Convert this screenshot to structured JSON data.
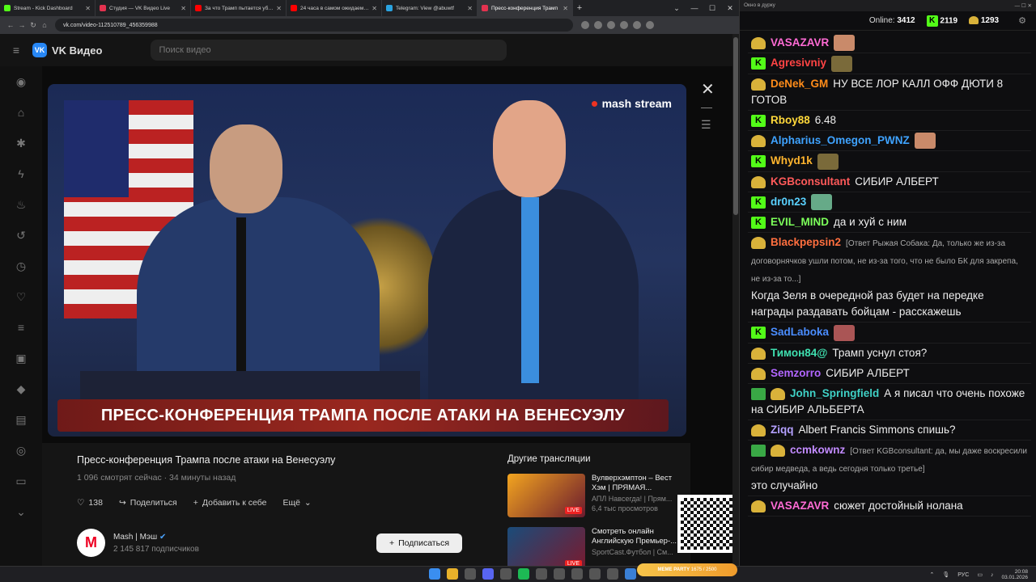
{
  "browser": {
    "tabs": [
      {
        "title": "Stream - Kick Dashboard",
        "color": "#53fc18"
      },
      {
        "title": "Студия — VK Видео Live",
        "color": "#e3324f"
      },
      {
        "title": "За что Трамп пытается убить",
        "color": "#ff0000"
      },
      {
        "title": "24 часа в самом ожидаемом",
        "color": "#ff0000"
      },
      {
        "title": "Telegram: View @abuwtf",
        "color": "#2aa3e0"
      },
      {
        "title": "Пресс-конференция Трамп",
        "color": "#e3324f"
      }
    ],
    "url": "vk.com/video-112510789_456359988",
    "ext_badge": "574"
  },
  "vk": {
    "logo": "VK Видео",
    "search_placeholder": "Поиск видео"
  },
  "player": {
    "brand": "mash stream",
    "lower_third": "ПРЕСС-КОНФЕРЕНЦИЯ ТРАМПА ПОСЛЕ АТАКИ НА ВЕНЕСУЭЛУ"
  },
  "video": {
    "title": "Пресс-конференция Трампа после атаки на Венесуэлу",
    "meta": "1 096 смотрят сейчас · 34 минуты назад",
    "likes": "138",
    "share": "Поделиться",
    "add": "Добавить к себе",
    "more": "Ещё",
    "channel": "Mash | Мэш",
    "subscribers": "2 145 817 подписчиков",
    "subscribe": "Подписаться"
  },
  "related": {
    "heading": "Другие трансляции",
    "items": [
      {
        "title": "Вулверхэмптон – Вест Хэм | ПРЯМАЯ...",
        "sub": "АПЛ Навсегда! | Прям...",
        "views": "6,4 тыс просмотров",
        "live": "LIVE"
      },
      {
        "title": "Смотреть онлайн Английскую Премьер-...",
        "sub": "SportCast.Футбол | См...",
        "views": "",
        "live": "LIVE"
      }
    ]
  },
  "chat": {
    "window_title": "Окно в дурку",
    "online_label": "Online:",
    "online": "3412",
    "kick_count": "2119",
    "gold_count": "1293",
    "messages": [
      {
        "badge": "g",
        "name": "VASAZAVR",
        "color": "#ff6bd5",
        "text": "",
        "reply": ""
      },
      {
        "badge": "k",
        "name": "Agresivniy",
        "color": "#ff4444",
        "text": "",
        "reply": ""
      },
      {
        "badge": "g",
        "name": "DeNek_GM",
        "color": "#ff8c1a",
        "text": "НУ ВСЕ ЛОР КАЛЛ ОФФ ДЮТИ 8 ГОТОВ",
        "reply": ""
      },
      {
        "badge": "k",
        "name": "Rboy88",
        "color": "#ffd83a",
        "text": "6.48",
        "reply": ""
      },
      {
        "badge": "g",
        "name": "Alpharius_Omegon_PWNZ",
        "color": "#3fa3ff",
        "text": "",
        "reply": ""
      },
      {
        "badge": "k",
        "name": "Whyd1k",
        "color": "#ffb52e",
        "text": "",
        "reply": ""
      },
      {
        "badge": "g",
        "name": "KGBconsultant",
        "color": "#ff5a5a",
        "text": "СИБИР АЛБЕРТ",
        "reply": ""
      },
      {
        "badge": "k",
        "name": "dr0n23",
        "color": "#5ad1ff",
        "text": "",
        "reply": ""
      },
      {
        "badge": "k",
        "name": "EVIL_MIND",
        "color": "#7cff5a",
        "text": "да и хуй с ним",
        "reply": ""
      },
      {
        "badge": "g",
        "name": "Blackpepsin2",
        "color": "#ff6f3f",
        "text": "Когда Зеля в очередной раз будет на передке награды раздавать бойцам - расскажешь",
        "reply": "[Ответ Рыжая Собака: Да, только же из-за договорнячков ушли потом, не из-за того, что не было БК для закрепа, не из-за то...]"
      },
      {
        "badge": "k",
        "name": "SadLaboka",
        "color": "#4a8dff",
        "text": "",
        "reply": ""
      },
      {
        "badge": "g",
        "name": "Тимон84@",
        "color": "#3fe0b0",
        "text": "Трамп уснул стоя?",
        "reply": ""
      },
      {
        "badge": "g",
        "name": "Semzorro",
        "color": "#b266ff",
        "text": "СИБИР АЛБЕРТ",
        "reply": ""
      },
      {
        "badge": "vg",
        "name": "John_Springfield",
        "color": "#3fd1c6",
        "text": "А я писал что очень похоже на СИБИР АЛЬБЕРТА",
        "reply": ""
      },
      {
        "badge": "g",
        "name": "Ziqq",
        "color": "#b4a0ff",
        "text": "Albert Francis Simmons спишь?",
        "reply": ""
      },
      {
        "badge": "vg",
        "name": "ccmkownz",
        "color": "#c28bff",
        "text": "это случайно",
        "reply": "[Ответ KGBconsultant: да, мы даже воскресили сибир медведа, а ведь сегодня только третье]"
      },
      {
        "badge": "g",
        "name": "VASAZAVR",
        "color": "#ff6bd5",
        "text": "сюжет достойный нолана",
        "reply": ""
      }
    ]
  },
  "taskbar": {
    "lang": "РУС",
    "time": "20:08",
    "date": "03.01.2026",
    "meme_party": "MEME PARTY",
    "meme_count": "1675 / 2500"
  }
}
